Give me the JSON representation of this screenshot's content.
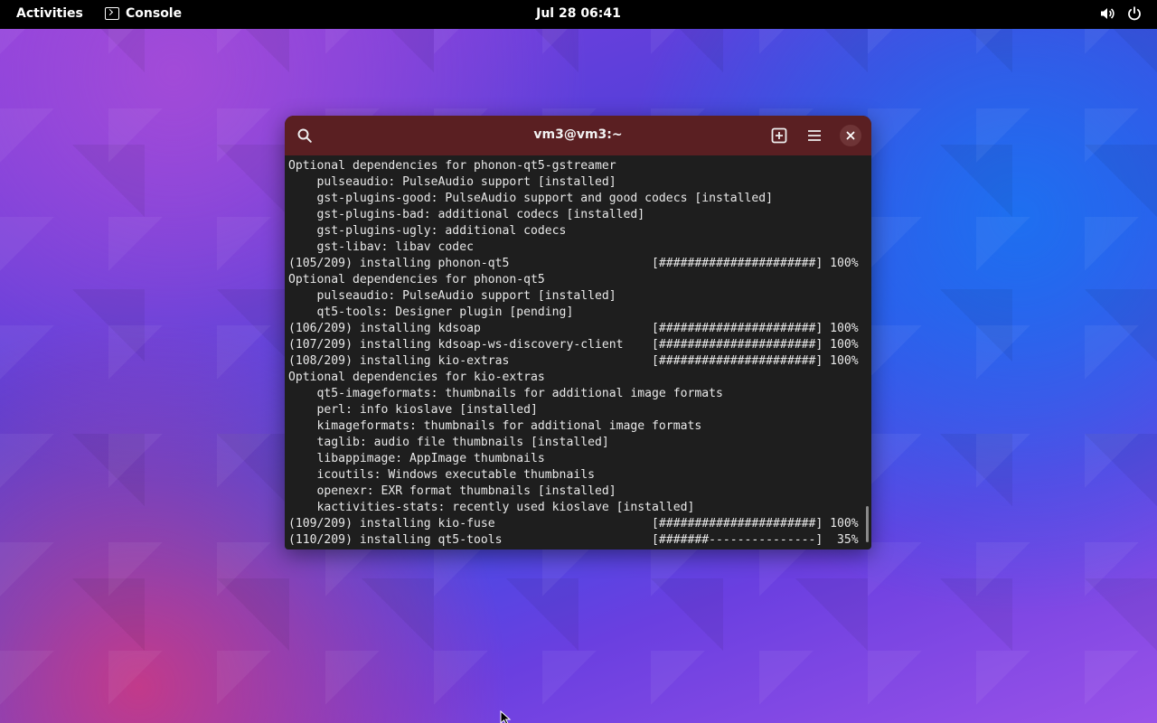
{
  "topbar": {
    "activities": "Activities",
    "app_name": "Console",
    "clock": "Jul 28  06:41",
    "icons": [
      "volume-icon",
      "power-icon"
    ]
  },
  "window": {
    "title": "vm3@vm3:~",
    "buttons": [
      "search-icon",
      "new-tab-icon",
      "menu-icon",
      "close-icon"
    ],
    "terminal_lines": [
      "Optional dependencies for phonon-qt5-gstreamer",
      "    pulseaudio: PulseAudio support [installed]",
      "    gst-plugins-good: PulseAudio support and good codecs [installed]",
      "    gst-plugins-bad: additional codecs [installed]",
      "    gst-plugins-ugly: additional codecs",
      "    gst-libav: libav codec",
      "(105/209) installing phonon-qt5                    [######################] 100%",
      "Optional dependencies for phonon-qt5",
      "    pulseaudio: PulseAudio support [installed]",
      "    qt5-tools: Designer plugin [pending]",
      "(106/209) installing kdsoap                        [######################] 100%",
      "(107/209) installing kdsoap-ws-discovery-client    [######################] 100%",
      "(108/209) installing kio-extras                    [######################] 100%",
      "Optional dependencies for kio-extras",
      "    qt5-imageformats: thumbnails for additional image formats",
      "    perl: info kioslave [installed]",
      "    kimageformats: thumbnails for additional image formats",
      "    taglib: audio file thumbnails [installed]",
      "    libappimage: AppImage thumbnails",
      "    icoutils: Windows executable thumbnails",
      "    openexr: EXR format thumbnails [installed]",
      "    kactivities-stats: recently used kioslave [installed]",
      "(109/209) installing kio-fuse                      [######################] 100%",
      "(110/209) installing qt5-tools                     [#######---------------]  35%"
    ]
  },
  "colors": {
    "titlebar": "#5a1f22",
    "terminal_bg": "#1e1e1e",
    "terminal_fg": "#e8e8e8"
  }
}
